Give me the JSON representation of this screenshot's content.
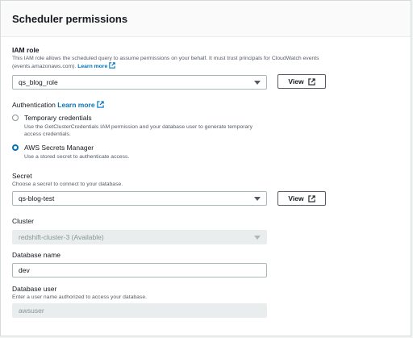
{
  "panel": {
    "title": "Scheduler permissions"
  },
  "iam": {
    "label": "IAM role",
    "description_line1": "This IAM role allows the scheduled query to assume permissions on your behalf. It must trust principals for CloudWatch events",
    "description_line2": "(events.amazonaws.com).",
    "learn_more": "Learn more",
    "selected": "qs_blog_role",
    "view_label": "View"
  },
  "auth": {
    "label": "Authentication",
    "learn_more": "Learn more",
    "options": [
      {
        "label": "Temporary credentials",
        "desc1": "Use the GetClusterCredentials IAM permission and your database user to generate temporary",
        "desc2": "access credentials.",
        "checked": false
      },
      {
        "label": "AWS Secrets Manager",
        "desc1": "Use a stored secret to authenticate access.",
        "checked": true
      }
    ]
  },
  "secret": {
    "label": "Secret",
    "description": "Choose a secret to connect to your database.",
    "selected": "qs-blog-test",
    "view_label": "View"
  },
  "cluster": {
    "label": "Cluster",
    "selected": "redshift-cluster-3 (Available)",
    "disabled": true
  },
  "database_name": {
    "label": "Database name",
    "value": "dev"
  },
  "database_user": {
    "label": "Database user",
    "description": "Enter a user name authorized to access your database.",
    "value": "awsuser",
    "disabled": true
  },
  "colors": {
    "accent": "#0073bb",
    "border": "#aab7b8",
    "disabled_bg": "#eaeded"
  }
}
